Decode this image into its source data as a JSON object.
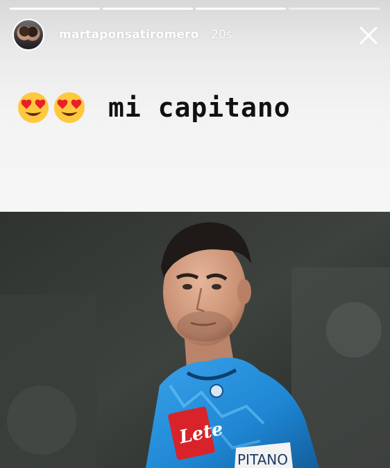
{
  "story": {
    "username": "martaponsatiromero",
    "time_ago": "20s",
    "progress": [
      1.0,
      1.0,
      1.0,
      0.0
    ],
    "caption": {
      "emojis": [
        "heart-eyes-emoji",
        "heart-eyes-emoji"
      ],
      "text": "mi capitano"
    },
    "photo": {
      "sponsor_text": "Lete",
      "armband_text": "PITANO"
    }
  },
  "icons": {
    "close": "close-icon"
  },
  "colors": {
    "shirt_blue": "#1e86d3",
    "sponsor_red": "#d8232a",
    "caption_text": "#111111"
  }
}
